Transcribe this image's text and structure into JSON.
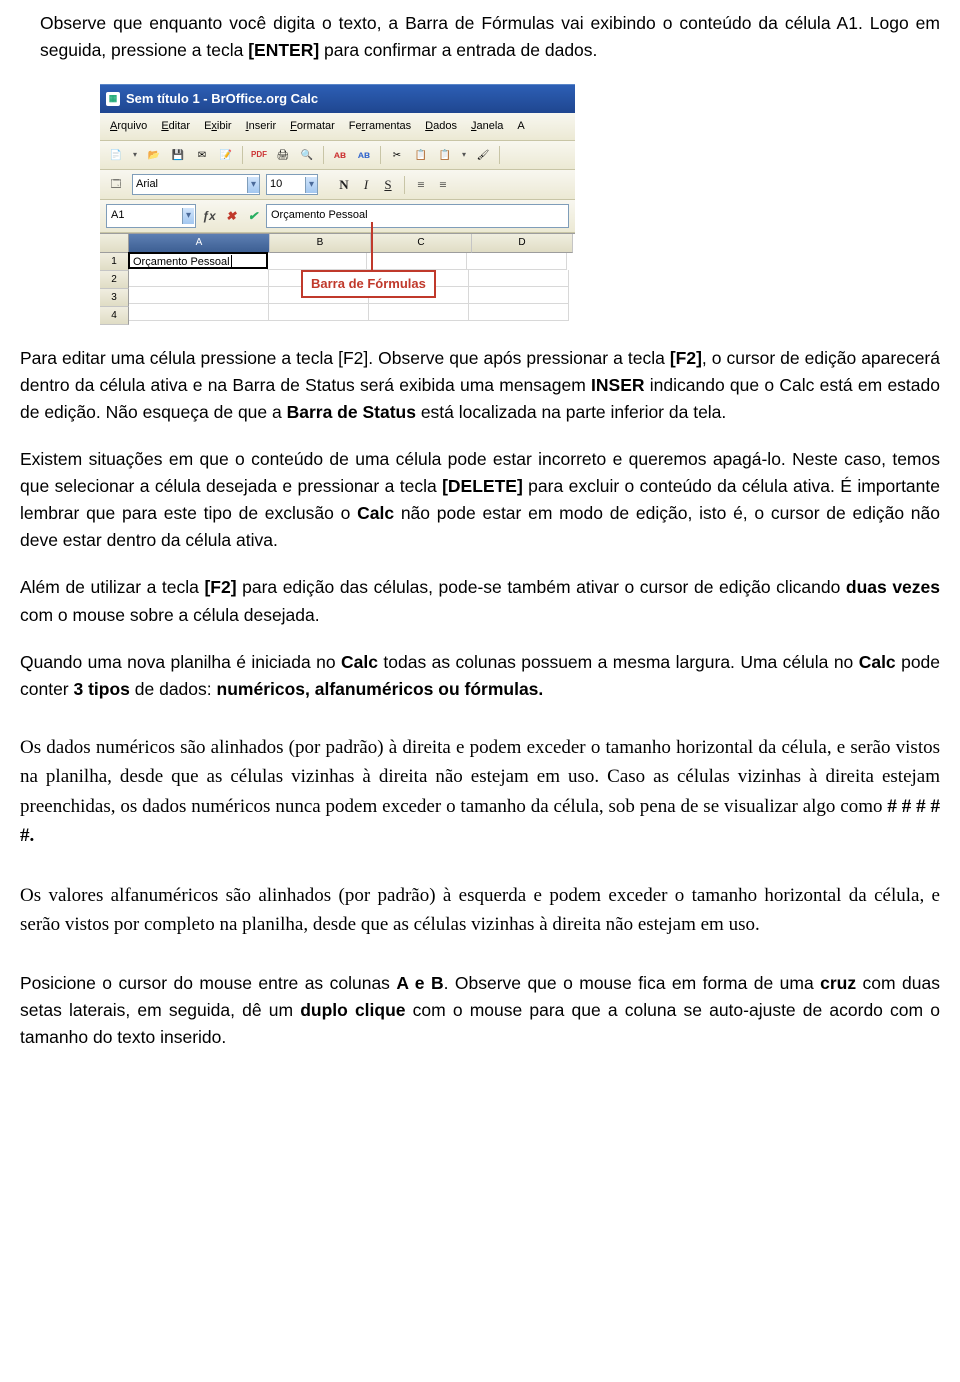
{
  "intro1_a": "Observe que enquanto você digita o texto, a Barra de Fórmulas vai exibindo o conteúdo da célula A1. Logo em seguida, pressione a tecla ",
  "intro1_key": "[ENTER]",
  "intro1_b": " para confirmar a entrada de dados.",
  "screenshot": {
    "title": "Sem título 1 - BrOffice.org Calc",
    "menus": [
      {
        "u": "A",
        "rest": "rquivo"
      },
      {
        "u": "E",
        "rest": "ditar"
      },
      {
        "u": "",
        "rest": "E",
        "u2": "x",
        "rest2": "ibir"
      },
      {
        "u": "I",
        "rest": "nserir"
      },
      {
        "u": "F",
        "rest": "ormatar"
      },
      {
        "u": "",
        "rest": "Fe",
        "u2": "r",
        "rest2": "ramentas"
      },
      {
        "u": "D",
        "rest": "ados"
      },
      {
        "u": "J",
        "rest": "anela"
      }
    ],
    "font_name": "Arial",
    "font_size": "10",
    "cell_ref": "A1",
    "formula_text": "Orçamento Pessoal",
    "columns": [
      "A",
      "B",
      "C",
      "D"
    ],
    "rows": [
      "1",
      "2",
      "3",
      "4"
    ],
    "a1_value": "Orçamento Pessoal",
    "label": "Barra de Fórmulas"
  },
  "p2_a": "Para editar uma célula pressione a tecla [F2]. Observe que após pressionar a tecla ",
  "p2_key1": "[F2]",
  "p2_b": ", o cursor de edição aparecerá dentro da célula ativa e na Barra de Status será exibida uma mensagem ",
  "p2_bold1": "INSER",
  "p2_c": " indicando que o Calc está em estado de edição. Não esqueça de que a ",
  "p2_bold2": "Barra de Status",
  "p2_d": " está localizada na parte inferior da tela.",
  "p3_a": "Existem situações em que o conteúdo de uma célula pode estar incorreto e queremos apagá-lo. Neste caso, temos que selecionar a célula desejada e pressionar a tecla ",
  "p3_key": "[DELETE]",
  "p3_b": " para excluir o conteúdo da célula ativa. É importante lembrar que para este tipo de exclusão o ",
  "p3_bold": "Calc",
  "p3_c": " não pode estar em modo de edição, isto é, o cursor de edição não deve estar dentro da célula ativa.",
  "p4_a": "Além de utilizar a tecla ",
  "p4_key": "[F2]",
  "p4_b": " para edição das células, pode-se também ativar o cursor de edição clicando ",
  "p4_bold": "duas vezes",
  "p4_c": " com o mouse sobre a célula desejada.",
  "p5_a": "Quando uma nova planilha é iniciada no ",
  "p5_bold1": "Calc",
  "p5_b": " todas as colunas possuem a mesma largura. Uma célula no ",
  "p5_bold2": "Calc",
  "p5_c": " pode conter ",
  "p5_bold3": "3 tipos",
  "p5_d": " de dados: ",
  "p5_bold4": "numéricos, alfanuméricos ou fórmulas.",
  "p6": "Os dados numéricos são alinhados (por padrão) à direita e podem exceder o tamanho horizontal da célula, e serão vistos na planilha, desde que as células vizinhas à direita não estejam em uso. Caso as células vizinhas à direita estejam preenchidas, os dados numéricos nunca podem exceder o tamanho da célula, sob pena de se visualizar algo como ",
  "p6_bold": "# # # # #.",
  "p7": "Os valores alfanuméricos são alinhados (por padrão) à esquerda e podem exceder o tamanho horizontal da célula, e serão vistos por completo na planilha, desde que as células vizinhas à direita não estejam em uso.",
  "p8_a": "Posicione o cursor do mouse entre as colunas ",
  "p8_bold1": "A e B",
  "p8_b": ". Observe que o mouse fica em forma de uma ",
  "p8_bold2": "cruz",
  "p8_c": " com duas setas laterais, em seguida, dê um ",
  "p8_bold3": "duplo clique",
  "p8_d": " com o mouse para que a coluna se auto-ajuste de acordo com o tamanho do texto inserido."
}
